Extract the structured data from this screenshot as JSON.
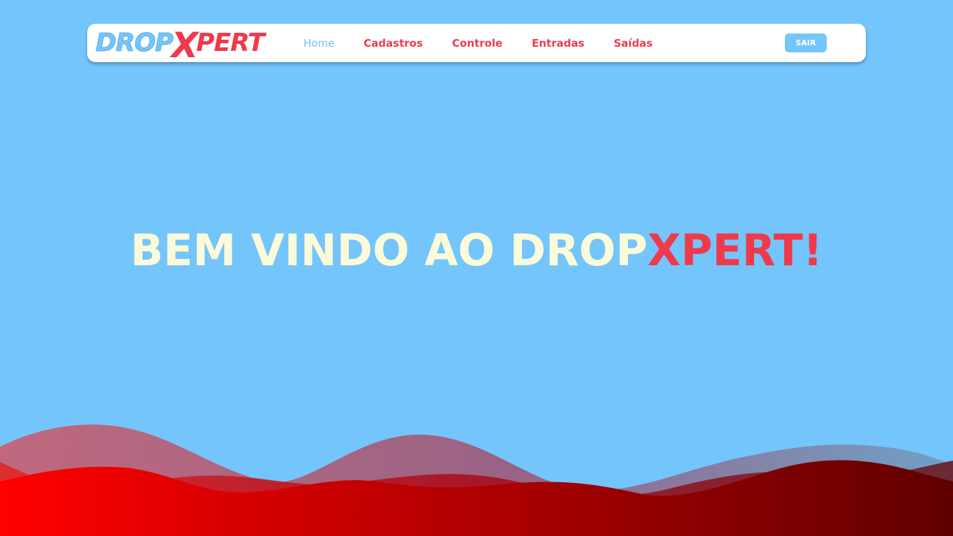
{
  "brand": {
    "logo_part1": "DROP",
    "logo_part2": "X",
    "logo_part3": "PERT"
  },
  "nav": {
    "items": [
      {
        "label": "Home",
        "active": true
      },
      {
        "label": "Cadastros",
        "active": false
      },
      {
        "label": "Controle",
        "active": false
      },
      {
        "label": "Entradas",
        "active": false
      },
      {
        "label": "Saídas",
        "active": false
      }
    ],
    "logout_label": "SAIR"
  },
  "hero": {
    "main_text": "BEM VINDO AO DROP",
    "accent_text": "XPERT!"
  },
  "colors": {
    "background": "#74c5fb",
    "accent_red": "#ef3a4c",
    "hero_text": "#fbfbd9",
    "navbar_bg": "#ffffff"
  }
}
